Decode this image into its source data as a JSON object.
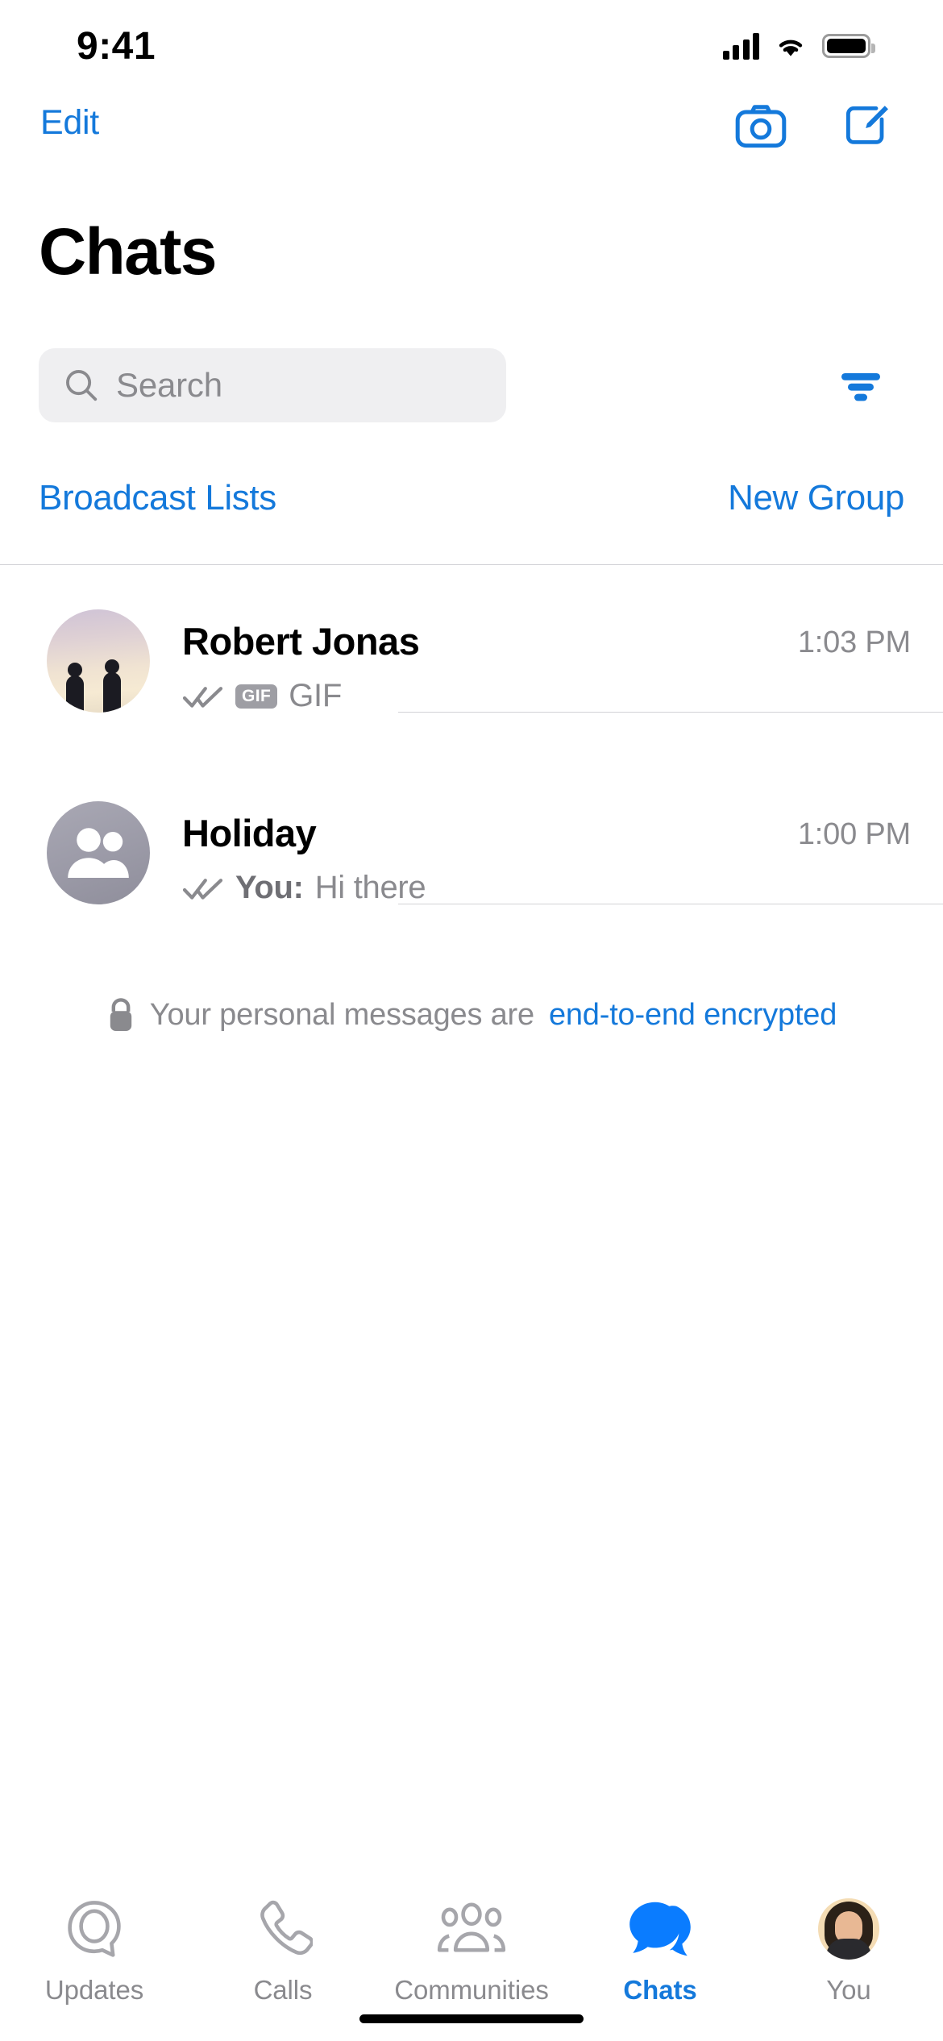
{
  "status_bar": {
    "time": "9:41",
    "cellular_icon": "cellular-bars-icon",
    "wifi_icon": "wifi-icon",
    "battery_icon": "battery-full-icon"
  },
  "nav_bar": {
    "edit_label": "Edit",
    "camera_icon": "camera-icon",
    "compose_icon": "compose-new-chat-icon"
  },
  "header": {
    "title": "Chats"
  },
  "search": {
    "placeholder": "Search",
    "value": "",
    "search_icon": "search-icon",
    "filter_icon": "filter-icon"
  },
  "actions": {
    "broadcast_label": "Broadcast Lists",
    "new_group_label": "New Group"
  },
  "chats": [
    {
      "name": "Robert Jonas",
      "time": "1:03 PM",
      "status_icon": "double-check-icon",
      "attachment_badge": "GIF",
      "preview": "GIF",
      "sender_prefix": "",
      "avatar_type": "photo"
    },
    {
      "name": "Holiday",
      "time": "1:00 PM",
      "status_icon": "double-check-icon",
      "attachment_badge": "",
      "preview": "Hi there",
      "sender_prefix": "You:",
      "avatar_type": "group"
    }
  ],
  "encryption_note": {
    "lock_icon": "lock-icon",
    "text": "Your personal messages are",
    "link": "end-to-end encrypted"
  },
  "tab_bar": {
    "items": [
      {
        "label": "Updates",
        "icon": "updates-status-icon",
        "active": false
      },
      {
        "label": "Calls",
        "icon": "phone-icon",
        "active": false
      },
      {
        "label": "Communities",
        "icon": "communities-icon",
        "active": false
      },
      {
        "label": "Chats",
        "icon": "chats-bubbles-icon",
        "active": true
      },
      {
        "label": "You",
        "icon": "profile-avatar-icon",
        "active": false
      }
    ]
  },
  "colors": {
    "accent": "#1479DB",
    "secondary_text": "#8A8A8E",
    "search_bg": "#EFEFF1",
    "divider": "#D2D2D6"
  }
}
